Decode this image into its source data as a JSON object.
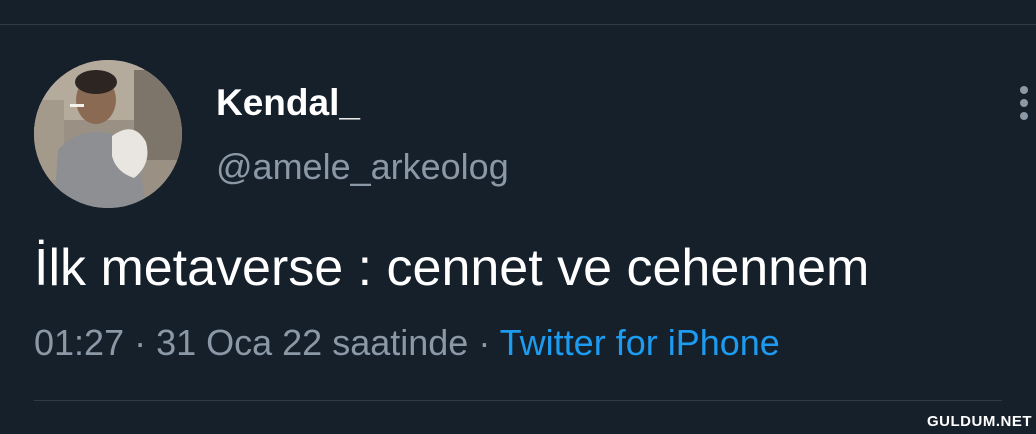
{
  "tweet": {
    "author": {
      "display_name": "Kendal_",
      "handle": "@amele_arkeolog",
      "avatar": "profile-photo"
    },
    "text": "İlk metaverse : cennet ve cehennem",
    "meta": {
      "time": "01:27",
      "separator1": " · ",
      "date": "31 Oca 22 saatinde",
      "separator2": " · ",
      "source": "Twitter for iPhone"
    },
    "more_icon": "more-vertical-icon"
  },
  "watermark": "GULDUM.NET",
  "colors": {
    "background": "#15202b",
    "primary_text": "#ffffff",
    "secondary_text": "#8b98a5",
    "link": "#1d9bf0",
    "divider": "#2f3b47"
  }
}
